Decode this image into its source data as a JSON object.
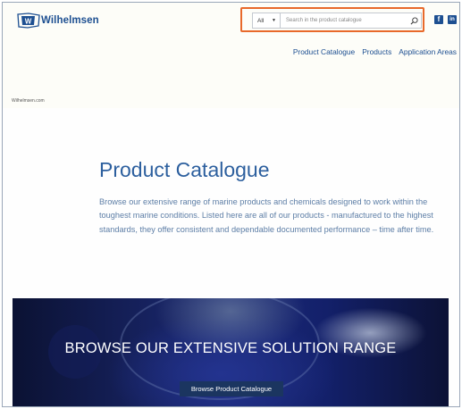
{
  "header": {
    "logo_text": "Wilhelmsen",
    "search": {
      "select_value": "All",
      "placeholder": "Search in the product catalogue"
    },
    "social": {
      "facebook": "f",
      "linkedin": "in"
    },
    "nav": [
      "Product Catalogue",
      "Products",
      "Application Areas"
    ]
  },
  "breadcrumb": "Wilhelmsen.com",
  "main": {
    "title": "Product Catalogue",
    "description": "Browse our extensive range of marine products and chemicals designed to work within the toughest marine conditions. Listed here are all of our products - manufactured to the highest standards, they offer consistent and dependable documented performance – time after time."
  },
  "banner": {
    "heading": "BROWSE OUR EXTENSIVE SOLUTION RANGE",
    "button_label": "Browse Product Catalogue"
  },
  "colors": {
    "brand": "#1d4f91",
    "highlight": "#e8692b",
    "button": "#1b3560"
  },
  "icons": [
    "wilhelmsen-logo-icon",
    "chevron-down-icon",
    "search-icon",
    "facebook-icon",
    "linkedin-icon"
  ]
}
